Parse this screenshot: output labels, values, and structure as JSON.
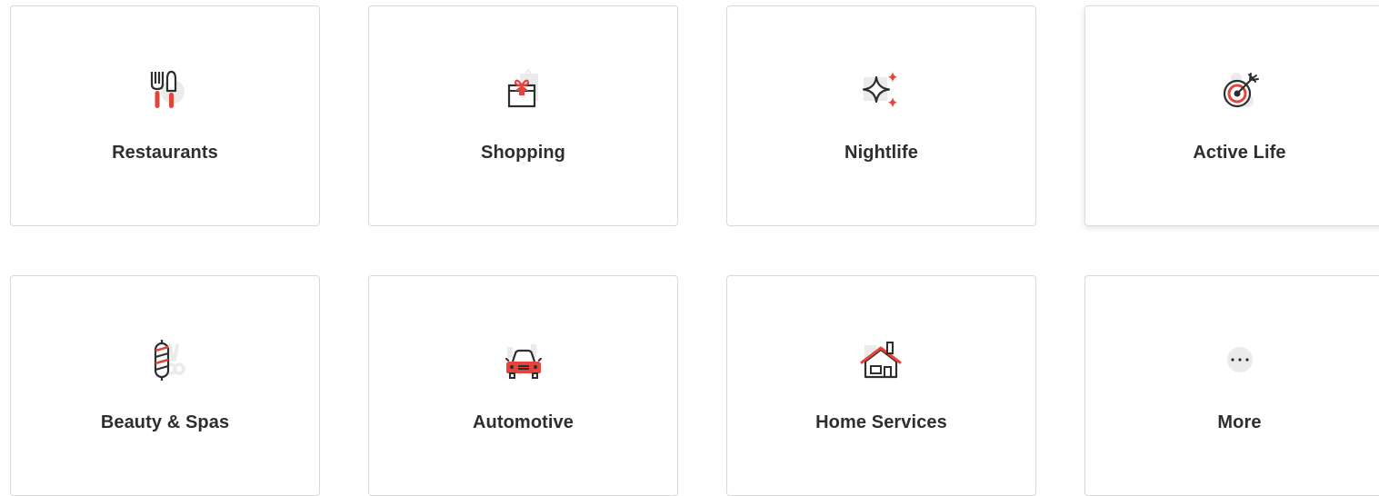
{
  "colors": {
    "accent": "#e4443a",
    "ink": "#2d2e2f",
    "shadow_gray": "#ebebeb",
    "border": "#d8d8d8"
  },
  "categories": [
    {
      "label": "Restaurants",
      "icon": "restaurant-icon"
    },
    {
      "label": "Shopping",
      "icon": "gift-icon"
    },
    {
      "label": "Nightlife",
      "icon": "sparkle-icon"
    },
    {
      "label": "Active Life",
      "icon": "target-icon"
    },
    {
      "label": "Beauty & Spas",
      "icon": "barber-pole-icon"
    },
    {
      "label": "Automotive",
      "icon": "car-icon"
    },
    {
      "label": "Home Services",
      "icon": "house-icon"
    },
    {
      "label": "More",
      "icon": "more-icon"
    }
  ]
}
